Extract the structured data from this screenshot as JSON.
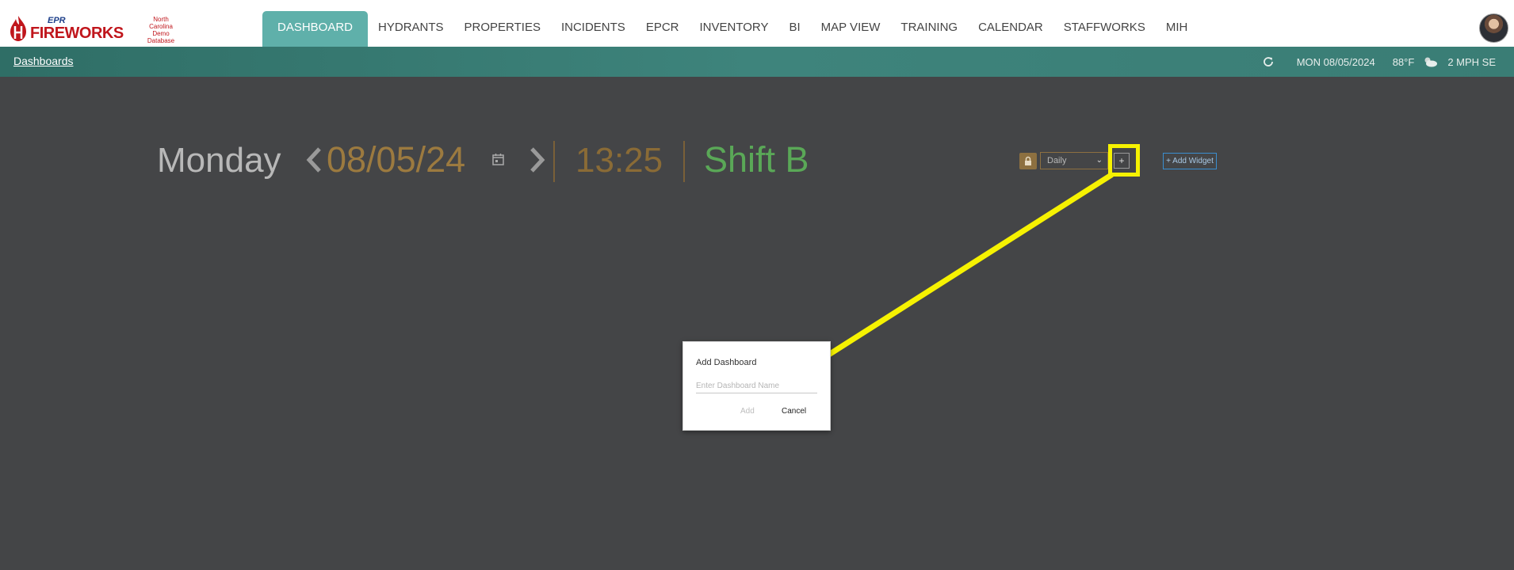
{
  "brand": {
    "top": "EPR",
    "name": "FIREWORKS",
    "database_label": "North Carolina Demo Database"
  },
  "nav": {
    "items": [
      "DASHBOARD",
      "HYDRANTS",
      "PROPERTIES",
      "INCIDENTS",
      "EPCR",
      "INVENTORY",
      "BI",
      "MAP VIEW",
      "TRAINING",
      "CALENDAR",
      "STAFFWORKS",
      "MIH"
    ],
    "active": "DASHBOARD"
  },
  "subbar": {
    "breadcrumb": "Dashboards",
    "date": "MON 08/05/2024",
    "temperature": "88°F",
    "wind": "2 MPH SE",
    "weather_icon": "partly-cloudy-icon"
  },
  "header": {
    "day": "Monday",
    "date": "08/05/24",
    "time": "13:25",
    "shift": "Shift B"
  },
  "controls": {
    "frequency": "Daily",
    "plus": "+",
    "add_widget": "+ Add Widget"
  },
  "dialog": {
    "title": "Add Dashboard",
    "placeholder": "Enter Dashboard Name",
    "add": "Add",
    "cancel": "Cancel"
  },
  "colors": {
    "background": "#444547",
    "nav_active": "#5fb0aa",
    "subbar": "#3a7d75",
    "date": "#9c7a3f",
    "shift": "#5aa857",
    "highlight": "#f6f201"
  }
}
